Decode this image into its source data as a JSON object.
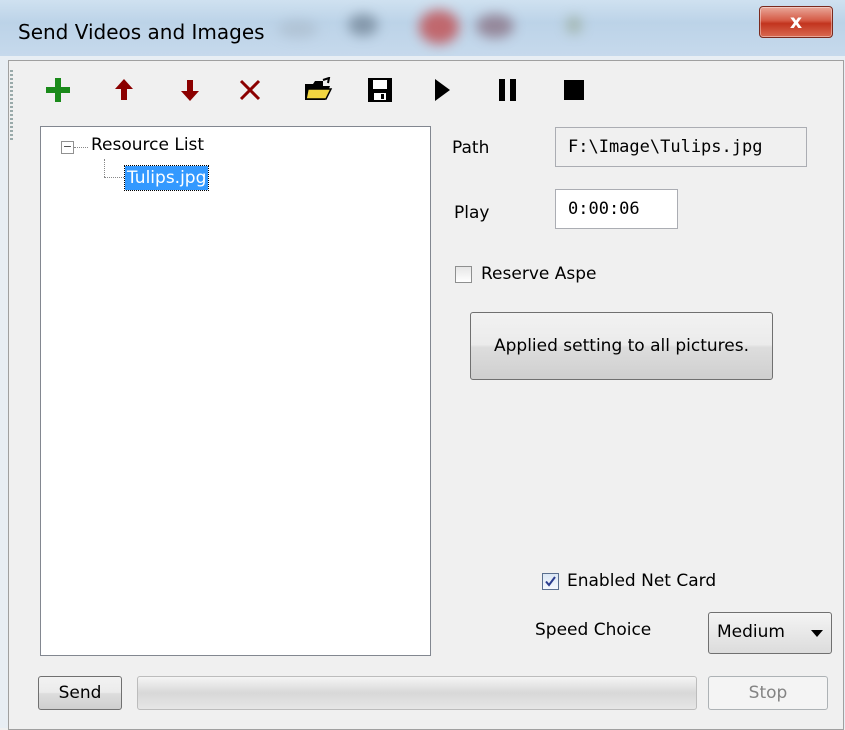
{
  "window": {
    "title": "Send Videos and Images",
    "close_label": "x"
  },
  "toolbar": {
    "buttons": [
      {
        "name": "add",
        "icon": "plus-icon",
        "color": "#1a8a1a"
      },
      {
        "name": "move-up",
        "icon": "arrow-up-icon",
        "color": "#8b0000"
      },
      {
        "name": "move-down",
        "icon": "arrow-down-icon",
        "color": "#8b0000"
      },
      {
        "name": "delete",
        "icon": "cross-icon",
        "color": "#8b0000"
      },
      {
        "name": "open",
        "icon": "open-folder-icon",
        "color": "#000000"
      },
      {
        "name": "save",
        "icon": "floppy-disk-icon",
        "color": "#000000"
      },
      {
        "name": "play",
        "icon": "play-icon",
        "color": "#000000"
      },
      {
        "name": "pause",
        "icon": "pause-icon",
        "color": "#000000"
      },
      {
        "name": "stop",
        "icon": "stop-icon",
        "color": "#000000"
      }
    ]
  },
  "tree": {
    "root_label": "Resource List",
    "expander": "−",
    "items": [
      "Tulips.jpg"
    ]
  },
  "details": {
    "path_label": "Path",
    "path_value": "F:\\Image\\Tulips.jpg",
    "play_label": "Play",
    "play_value": "0:00:06",
    "reserve_aspect_label": "Reserve Aspe",
    "reserve_aspect_checked": false,
    "apply_all_label": "Applied setting to all pictures.",
    "enabled_net_card_label": "Enabled Net Card",
    "enabled_net_card_checked": true,
    "speed_choice_label": "Speed Choice",
    "speed_choice_value": "Medium"
  },
  "footer": {
    "send_label": "Send",
    "stop_label": "Stop",
    "progress": 0
  }
}
